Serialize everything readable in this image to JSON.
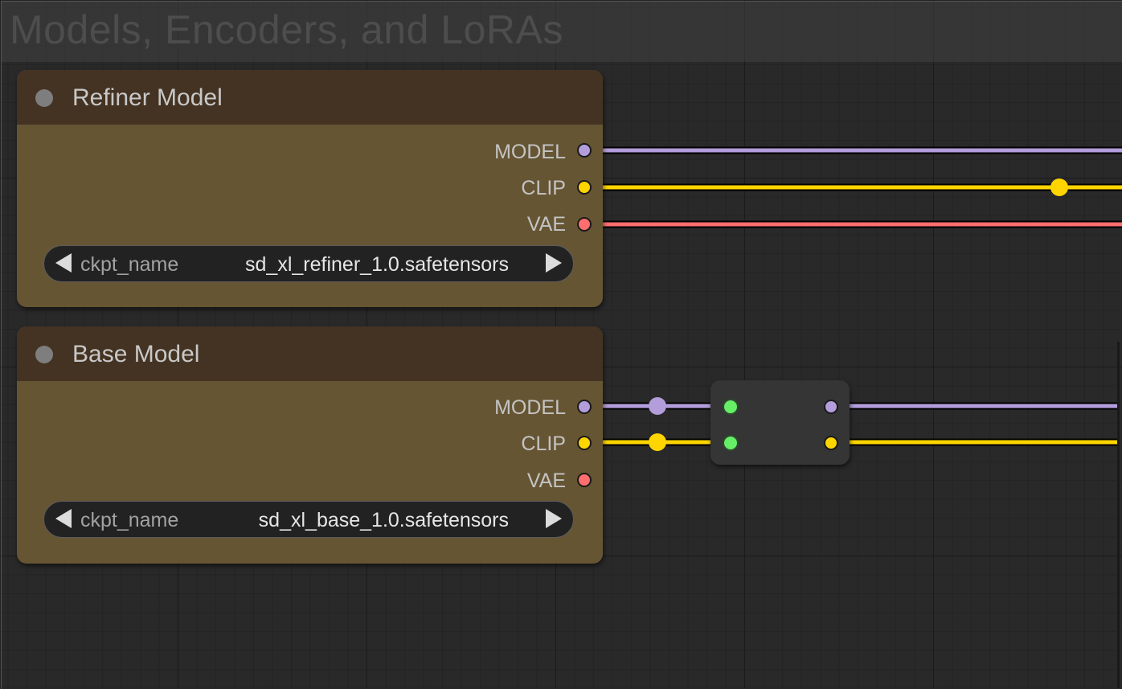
{
  "group": {
    "title": "Models, Encoders, and LoRAs"
  },
  "colors": {
    "model_wire": "#b39ddb",
    "clip_wire": "#ffd500",
    "vae_wire": "#ff6e6e",
    "node_body": "#665533",
    "node_header": "#443322",
    "reroute_input": "#66ee66"
  },
  "nodes": {
    "refiner": {
      "title": "Refiner Model",
      "outputs": [
        "MODEL",
        "CLIP",
        "VAE"
      ],
      "widget": {
        "name": "ckpt_name",
        "value": "sd_xl_refiner_1.0.safetensors",
        "left_icon": "arrow-left-icon",
        "right_icon": "arrow-right-icon"
      }
    },
    "base": {
      "title": "Base Model",
      "outputs": [
        "MODEL",
        "CLIP",
        "VAE"
      ],
      "widget": {
        "name": "ckpt_name",
        "value": "sd_xl_base_1.0.safetensors",
        "left_icon": "arrow-left-icon",
        "right_icon": "arrow-right-icon"
      }
    }
  }
}
